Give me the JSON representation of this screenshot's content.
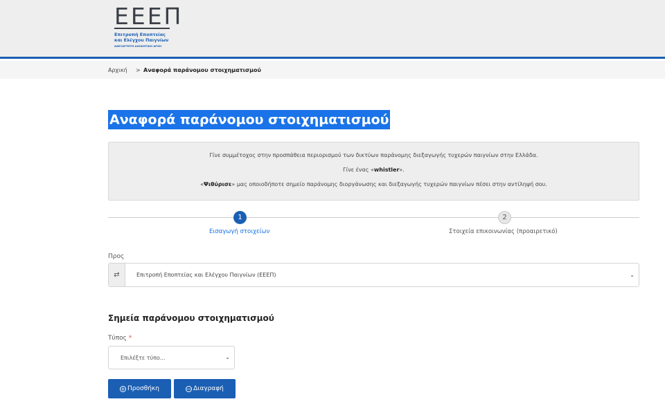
{
  "header": {
    "logo_mark": "ΕΕΕΠ",
    "logo_line1": "Επιτροπή Εποπτείας",
    "logo_line2": "και Ελέγχου Παιγνίων",
    "logo_line3": "ΑΝΕΞΑΡΤΗΤΗ ΔΙΟΙΚΗΤΙΚΗ ΑΡΧΗ",
    "accent_color": "#1a5fb4"
  },
  "breadcrumb": {
    "home": "Αρχική",
    "separator": ">",
    "current": "Αναφορά παράνομου στοιχηματισμού"
  },
  "page": {
    "title": "Αναφορά παράνομου στοιχηματισμού"
  },
  "info": {
    "line1": "Γίνε συμμέτοχος στην προσπάθεια περιορισμού των δικτύων παράνομης διεξαγωγής τυχερών παιγνίων στην Ελλάδα.",
    "line2_pre": "Γίνε ένας «",
    "line2_bold": "whistler",
    "line2_post": "».",
    "line3_pre": "«",
    "line3_bold": "Ψιθύρισε",
    "line3_post": "» μας οποιοδήποτε σημείο παράνομης διοργάνωσης και διεξαγωγής τυχερών παιγνίων πέσει στην αντίληψή σου."
  },
  "stepper": {
    "steps": [
      {
        "number": "1",
        "label": "Εισαγωγή στοιχείων",
        "active": true
      },
      {
        "number": "2",
        "label": "Στοιχεία επικοινωνίας (προαιρετικό)",
        "active": false
      }
    ]
  },
  "form": {
    "to_label": "Προς",
    "to_value": "Επιτροπή Εποπτείας και Ελέγχου Παιγνίων (ΕΕΕΠ)",
    "swap_icon": "⇄",
    "section_title": "Σημεία παράνομου στοιχηματισμού",
    "type_label": "Τύπος",
    "required_mark": "*",
    "type_placeholder": "Επιλέξτε τύπο...",
    "chevron": "⌄",
    "add_icon": "+",
    "add_label": "Προσθήκη",
    "delete_icon": "−",
    "delete_label": "Διαγραφή"
  }
}
